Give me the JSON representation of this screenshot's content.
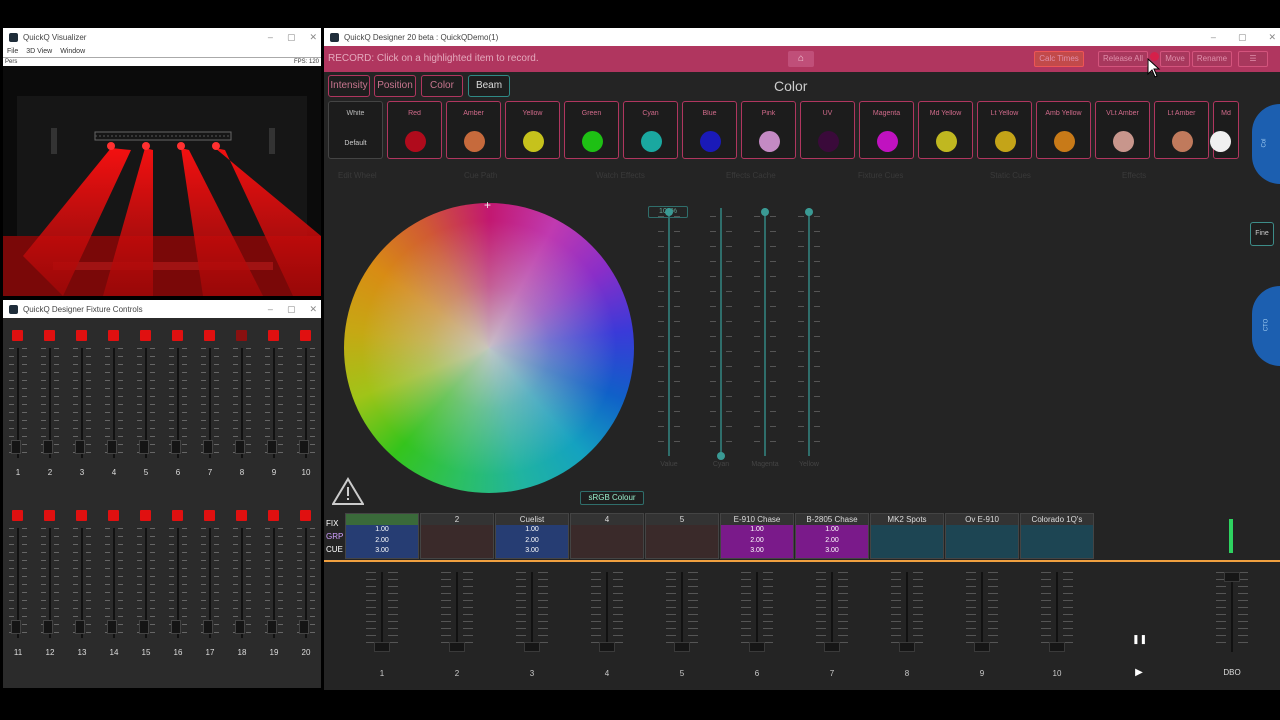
{
  "visualizer": {
    "title": "QuickQ Visualizer",
    "menu": [
      "File",
      "3D View",
      "Window"
    ],
    "view_label": "Pers",
    "fps": "FPS: 120"
  },
  "fixture_controls": {
    "title": "QuickQ Designer Fixture Controls",
    "bank1": [
      "1",
      "2",
      "3",
      "4",
      "5",
      "6",
      "7",
      "8",
      "9",
      "10"
    ],
    "bank2": [
      "11",
      "12",
      "13",
      "14",
      "15",
      "16",
      "17",
      "18",
      "19",
      "20"
    ]
  },
  "designer": {
    "title": "QuickQ Designer 20 beta : QuickQDemo(1)",
    "record_text": "RECORD: Click on a highlighted item to record.",
    "record_buttons": {
      "calc_times": "Calc Times",
      "release_all": "Release All",
      "move": "Move",
      "rename": "Rename"
    },
    "mode_tabs": [
      "Intensity",
      "Position",
      "Color",
      "Beam"
    ],
    "heading": "Color",
    "swatches": [
      {
        "name": "White",
        "sub": "Default"
      },
      {
        "name": "Red",
        "color": "#b00b1c"
      },
      {
        "name": "Amber",
        "color": "#c66a3c"
      },
      {
        "name": "Yellow",
        "color": "#c6c21c"
      },
      {
        "name": "Green",
        "color": "#1ec014"
      },
      {
        "name": "Cyan",
        "color": "#1aa8a0"
      },
      {
        "name": "Blue",
        "color": "#1a1ab8"
      },
      {
        "name": "Pink",
        "color": "#c48ac4"
      },
      {
        "name": "UV",
        "color": "#3a0a3a"
      },
      {
        "name": "Magenta",
        "color": "#c012c0"
      },
      {
        "name": "Md Yellow",
        "color": "#c0b820"
      },
      {
        "name": "Lt Yellow",
        "color": "#c4a418"
      },
      {
        "name": "Amb Yellow",
        "color": "#c87a18"
      },
      {
        "name": "VLt Amber",
        "color": "#c8968c"
      },
      {
        "name": "Lt Amber",
        "color": "#c07a5c"
      },
      {
        "name": "Md",
        "color": "#f0f0f0"
      }
    ],
    "side_tabs": [
      "Col",
      "CTO"
    ],
    "fine_label": "Fine",
    "faded_tabs": [
      "Edit Wheel",
      "Cue Path",
      "Watch Effects",
      "Effects Cache",
      "Fixture Cues",
      "Static Cues",
      "Effects"
    ],
    "srgb_label": "sRGB Colour",
    "percent_badge": "100%",
    "color_sliders": [
      {
        "label": "Value",
        "level": 1.0
      },
      {
        "label": "Cyan",
        "level": 0.0
      },
      {
        "label": "Magenta",
        "level": 1.0
      },
      {
        "label": "Yellow",
        "level": 1.0
      }
    ],
    "row_labels": {
      "fix": "FIX",
      "grp": "GRP",
      "cue": "CUE"
    },
    "playbacks": [
      {
        "name": "",
        "style": "blue green",
        "values": [
          "1.00",
          "2.00",
          "3.00"
        ]
      },
      {
        "name": "2",
        "style": "dark",
        "values": []
      },
      {
        "name": "Cuelist",
        "style": "blue",
        "values": [
          "1.00",
          "2.00",
          "3.00"
        ]
      },
      {
        "name": "4",
        "style": "dark",
        "values": []
      },
      {
        "name": "5",
        "style": "dark",
        "values": []
      },
      {
        "name": "E-910 Chase",
        "style": "purple",
        "values": [
          "1.00",
          "2.00",
          "3.00"
        ]
      },
      {
        "name": "B-2805 Chase",
        "style": "purple",
        "values": [
          "1.00",
          "2.00",
          "3.00"
        ]
      },
      {
        "name": "MK2 Spots",
        "style": "teal",
        "values": []
      },
      {
        "name": "Ov E-910",
        "style": "teal",
        "values": []
      },
      {
        "name": "Colorado 1Q's",
        "style": "teal",
        "values": []
      }
    ],
    "playback_numbers": [
      "1",
      "2",
      "3",
      "4",
      "5",
      "6",
      "7",
      "8",
      "9",
      "10"
    ],
    "dbo_label": "DBO"
  }
}
